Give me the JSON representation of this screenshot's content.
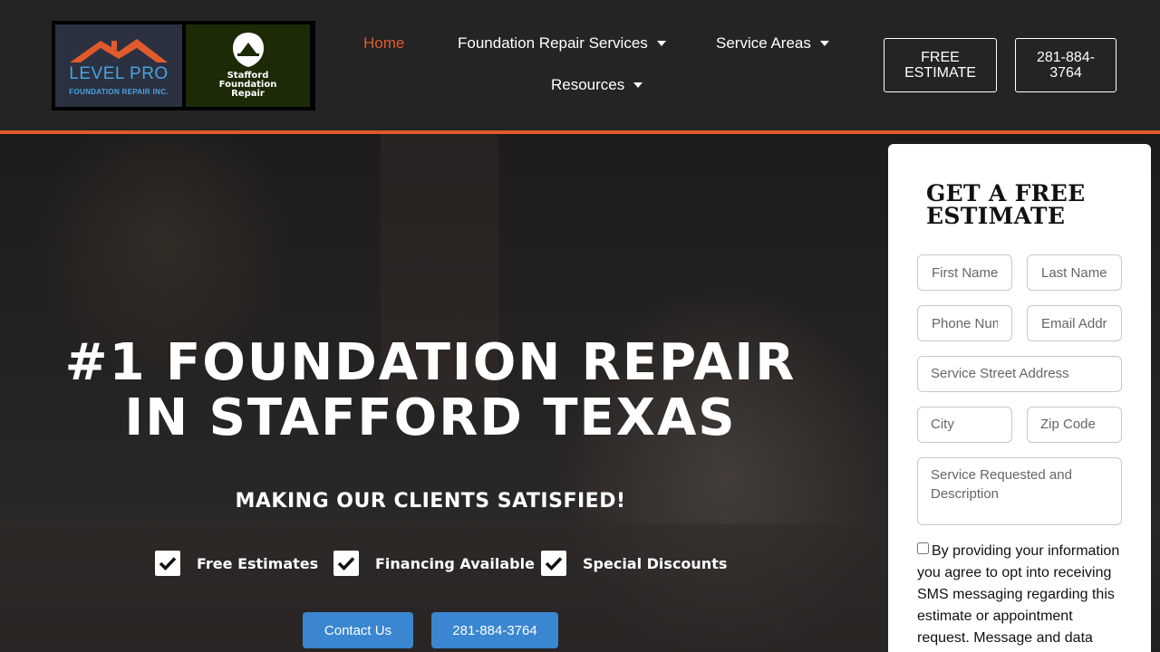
{
  "brand": {
    "logo_main": "LEVEL PRO",
    "logo_sub": "FOUNDATION REPAIR INC.",
    "partner_lines": [
      "Stafford",
      "Foundation",
      "Repair"
    ],
    "accent_color": "#e05a2b",
    "button_color": "#3a86d0"
  },
  "nav": {
    "home": "Home",
    "services": "Foundation Repair Services",
    "areas": "Service Areas",
    "resources": "Resources",
    "free_estimate": "FREE ESTIMATE",
    "phone": "281-884-3764"
  },
  "hero": {
    "title": "#1 FOUNDATION REPAIR IN STAFFORD TEXAS",
    "subtitle": "MAKING OUR CLIENTS SATISFIED!",
    "features": [
      "Free Estimates",
      "Financing Available",
      "Special Discounts"
    ],
    "contact_button": "Contact Us",
    "phone_button": "281-884-3764"
  },
  "form": {
    "title": "GET A FREE ESTIMATE",
    "first_name": "First Name",
    "last_name": "Last Name",
    "phone": "Phone Number",
    "email": "Email Address",
    "street": "Service Street Address",
    "city": "City",
    "zip": "Zip Code",
    "description": "Service Requested and Description",
    "consent": "By providing your information you agree to opt into receiving SMS messaging regarding this estimate or appointment request. Message and data"
  }
}
